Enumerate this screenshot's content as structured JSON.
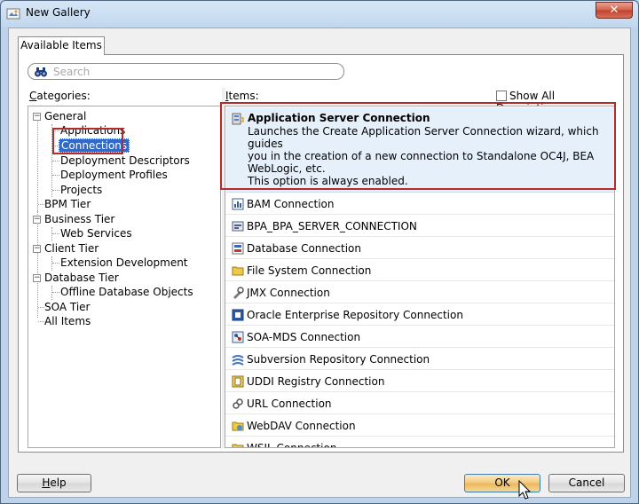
{
  "window": {
    "title": "New Gallery",
    "close_glyph": "✕"
  },
  "tab": {
    "label": "Available Items"
  },
  "search": {
    "placeholder": "Search"
  },
  "categories": {
    "label_prefix": "C",
    "label_rest": "ategories:",
    "items": [
      {
        "label": "General",
        "level": 0,
        "expander": "−"
      },
      {
        "label": "Applications",
        "level": 1
      },
      {
        "label": "Connections",
        "level": 1,
        "selected": true
      },
      {
        "label": "Deployment Descriptors",
        "level": 1
      },
      {
        "label": "Deployment Profiles",
        "level": 1
      },
      {
        "label": "Projects",
        "level": 1
      },
      {
        "label": "BPM Tier",
        "level": 0
      },
      {
        "label": "Business Tier",
        "level": 0,
        "expander": "−"
      },
      {
        "label": "Web Services",
        "level": 1
      },
      {
        "label": "Client Tier",
        "level": 0,
        "expander": "−"
      },
      {
        "label": "Extension Development",
        "level": 1
      },
      {
        "label": "Database Tier",
        "level": 0,
        "expander": "−"
      },
      {
        "label": "Offline Database Objects",
        "level": 1
      },
      {
        "label": "SOA Tier",
        "level": 0
      },
      {
        "label": "All Items",
        "level": 0
      }
    ]
  },
  "items_panel": {
    "label_prefix": "I",
    "label_rest": "tems:",
    "show_all_label": "Show All Descriptions",
    "selected": {
      "title": "Application Server Connection",
      "description": "Launches the Create Application Server Connection wizard, which guides\nyou in the creation of a new connection to Standalone OC4J, BEA\nWebLogic, etc.",
      "note": "This option is always enabled."
    },
    "items": [
      {
        "label": "BAM Connection",
        "icon": "bam-icon"
      },
      {
        "label": "BPA_BPA_SERVER_CONNECTION",
        "icon": "bpa-icon"
      },
      {
        "label": "Database Connection",
        "icon": "database-icon"
      },
      {
        "label": "File System Connection",
        "icon": "folder-icon"
      },
      {
        "label": "JMX Connection",
        "icon": "jmx-icon"
      },
      {
        "label": "Oracle Enterprise Repository Connection",
        "icon": "repository-icon"
      },
      {
        "label": "SOA-MDS Connection",
        "icon": "soa-icon"
      },
      {
        "label": "Subversion Repository Connection",
        "icon": "subversion-icon"
      },
      {
        "label": "UDDI Registry Connection",
        "icon": "uddi-icon"
      },
      {
        "label": "URL Connection",
        "icon": "url-icon"
      },
      {
        "label": "WebDAV Connection",
        "icon": "webdav-icon"
      },
      {
        "label": "WSIL Connection",
        "icon": "wsil-icon"
      }
    ]
  },
  "buttons": {
    "help_prefix": "H",
    "help_rest": "elp",
    "ok": "OK",
    "cancel": "Cancel"
  },
  "colors": {
    "accent": "#3169c6",
    "highlight_border": "#b52a2a",
    "selected_bg": "#e6f0fa"
  }
}
